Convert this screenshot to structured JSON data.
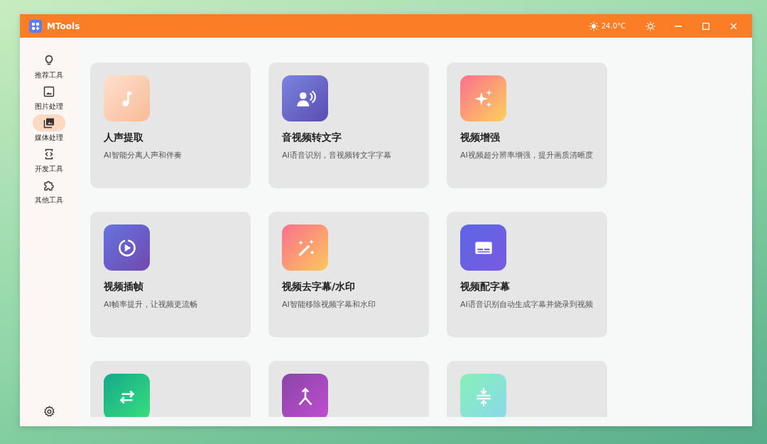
{
  "window": {
    "title": "MTools",
    "temperature": "24.0°C"
  },
  "sidebar": {
    "items": [
      {
        "label": "推荐工具",
        "selected": false
      },
      {
        "label": "图片处理",
        "selected": false
      },
      {
        "label": "媒体处理",
        "selected": true
      },
      {
        "label": "开发工具",
        "selected": false
      },
      {
        "label": "其他工具",
        "selected": false
      }
    ]
  },
  "cards": [
    {
      "kind": "tool",
      "title": "人声提取",
      "description": "AI智能分离人声和伴奏"
    },
    {
      "kind": "tool",
      "title": "音视频转文字",
      "description": "AI语音识别，音视频转文字字幕"
    },
    {
      "kind": "tool",
      "title": "视频增强",
      "description": "AI视频超分辨率增强，提升画质清晰度"
    },
    {
      "kind": "tool",
      "title": "视频插帧",
      "description": "AI帧率提升，让视频更流畅"
    },
    {
      "kind": "tool",
      "title": "视频去字幕/水印",
      "description": "AI智能移除视频字幕和水印"
    },
    {
      "kind": "tool",
      "title": "视频配字幕",
      "description": "AI语音识别自动生成字幕并烧录到视频"
    },
    {
      "kind": "tool"
    },
    {
      "kind": "tool"
    },
    {
      "kind": "tool"
    }
  ]
}
